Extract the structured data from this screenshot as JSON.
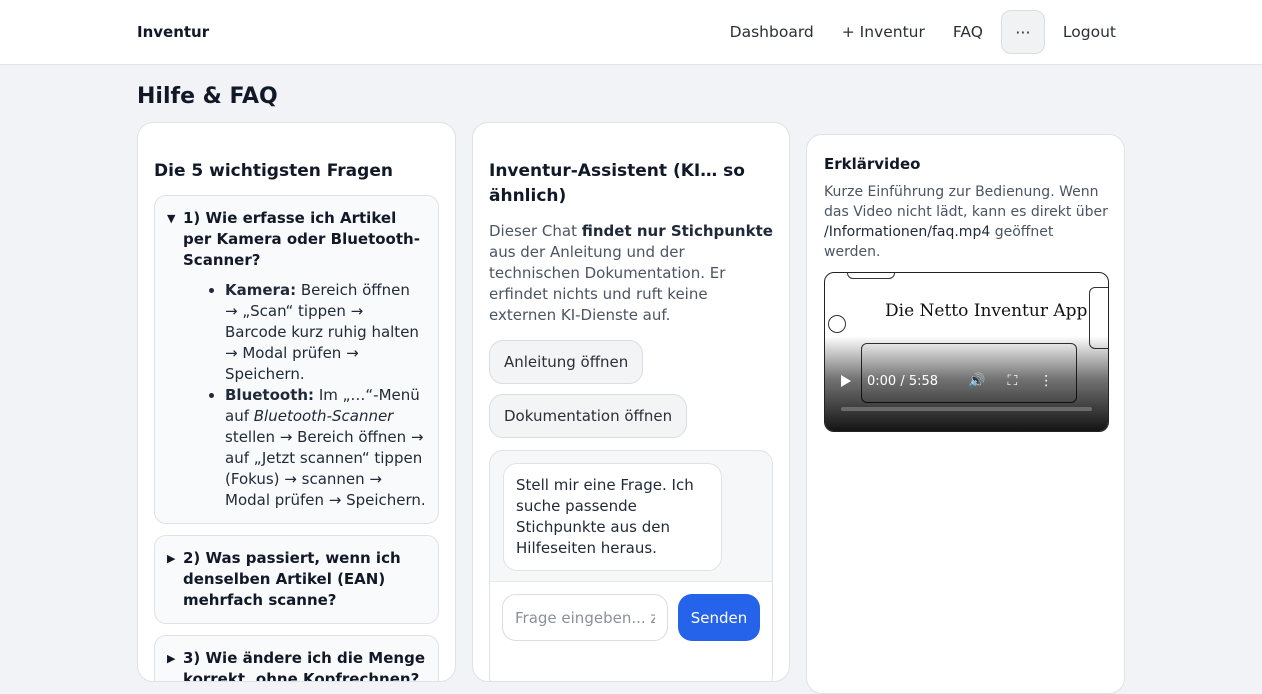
{
  "navbar": {
    "brand": "Inventur",
    "links": {
      "dashboard": "Dashboard",
      "add_inventory": "+ Inventur",
      "faq": "FAQ",
      "more": "···",
      "logout": "Logout"
    }
  },
  "page": {
    "title": "Hilfe & FAQ"
  },
  "faq": {
    "heading": "Die 5 wichtigsten Fragen",
    "items": [
      {
        "question": "1) Wie erfasse ich Artikel per Kamera oder Bluetooth-Scanner?",
        "expanded": true,
        "answer": {
          "camera_label": "Kamera:",
          "camera_text": " Bereich öffnen → „Scan“ tippen → Barcode kurz ruhig halten → Modal prüfen → Speichern.",
          "bt_label": "Bluetooth:",
          "bt_text_1": " Im „…“-Menü auf ",
          "bt_italic": "Bluetooth-Scanner",
          "bt_text_2": " stellen → Bereich öffnen → auf „Jetzt scannen“ tippen (Fokus) → scannen → Modal prüfen → Speichern."
        }
      },
      {
        "question": "2) Was passiert, wenn ich denselben Artikel (EAN) mehrfach scanne?",
        "expanded": false
      },
      {
        "question": "3) Wie ändere ich die Menge korrekt, ohne Kopfrechnen?",
        "expanded": false
      }
    ],
    "tri_open": "▼",
    "tri_closed": "▶"
  },
  "chat": {
    "heading": "Inventur-Assistent (KI… so ähnlich)",
    "intro_1": "Dieser Chat ",
    "intro_bold": "findet nur Stichpunkte",
    "intro_2": " aus der Anleitung und der technischen Dokumentation. Er erfindet nichts und ruft keine externen KI-Dienste auf.",
    "btn_manual": "Anleitung öffnen",
    "btn_docs": "Dokumentation öffnen",
    "bot_message": "Stell mir eine Frage. Ich suche passende Stichpunkte aus den Hilfeseiten heraus.",
    "input_placeholder": "Frage eingeben... z.B.",
    "send": "Senden"
  },
  "video": {
    "heading": "Erklärvideo",
    "desc_1": "Kurze Einführung zur Bedienung. Wenn das Video nicht lädt, kann es direkt über ",
    "desc_path": "/Informationen/faq.mp4",
    "desc_2": " geöffnet werden.",
    "video_title": "Die Netto Inventur App",
    "time": "0:00 / 5:58",
    "progress": 0,
    "icons": {
      "play": "play-icon",
      "volume": "volume-icon",
      "fullscreen": "fullscreen-icon",
      "menu": "kebab-menu-icon"
    }
  }
}
